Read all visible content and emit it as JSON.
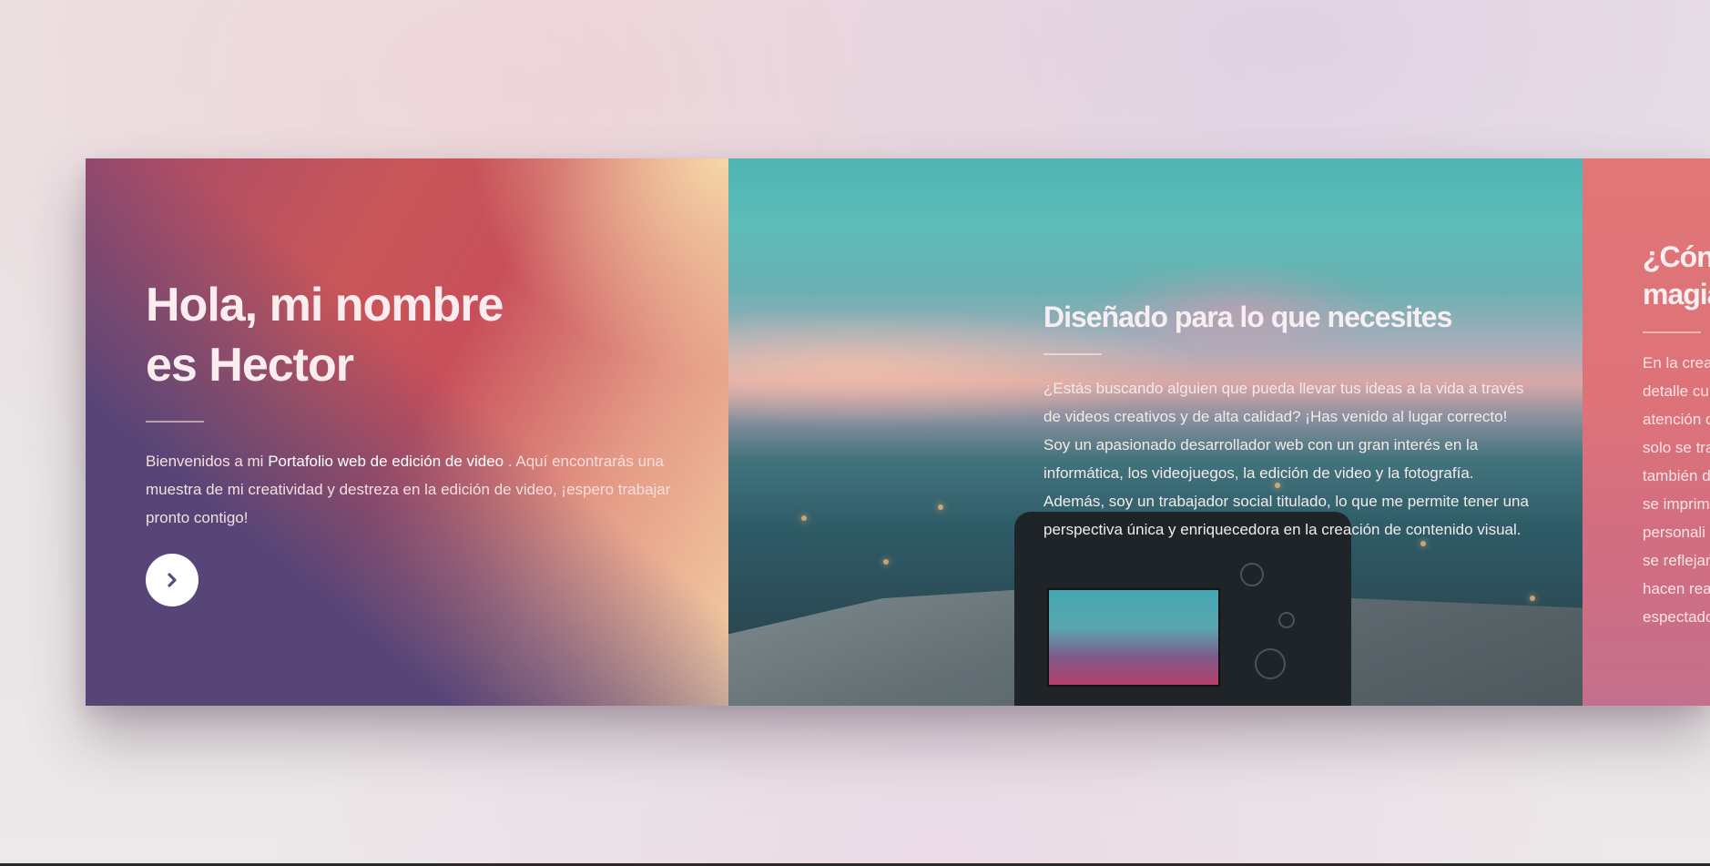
{
  "panels": {
    "intro": {
      "title_line1": "Hola, mi nombre",
      "title_line2": "es Hector",
      "text_before": "Bienvenidos a mi ",
      "text_link": "Portafolio web de edición de video",
      "text_after": " . Aquí encontrarás una muestra de mi creatividad y destreza en la edición de video, ¡espero trabajar pronto contigo!",
      "next_button_icon": "chevron-right-icon"
    },
    "about": {
      "title": "Diseñado para lo que necesites",
      "body": "¿Estás buscando alguien que pueda llevar tus ideas a la vida a través de videos creativos y de alta calidad? ¡Has venido al lugar correcto! Soy un apasionado desarrollador web con un gran interés en la informática, los videojuegos, la edición de video y la fotografía. Además, soy un trabajador social titulado, lo que me permite tener una perspectiva única y enriquecedora en la creación de contenido visual."
    },
    "magic": {
      "title_line1": "¿Cón",
      "title_line2": "magia",
      "body_lines": [
        "En la crea",
        "detalle cu",
        "atención c",
        "solo se tra",
        "también d",
        "se imprim",
        "personali",
        "se reflejan",
        "hacen rea",
        "espectado"
      ]
    }
  },
  "colors": {
    "purple": "#574578",
    "coral": "#c84f5a",
    "peach": "#f4d0a4",
    "teal": "#4fb5b3",
    "pink": "#e17677"
  }
}
